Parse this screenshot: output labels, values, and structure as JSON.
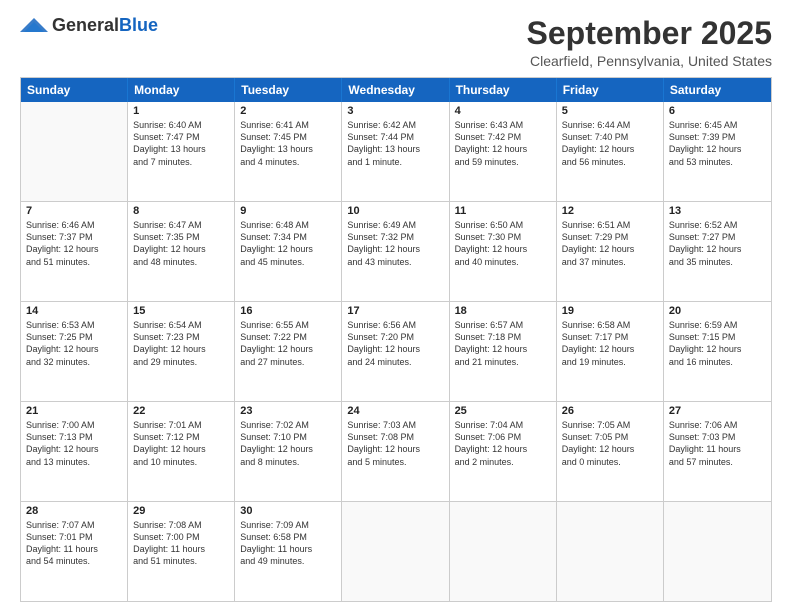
{
  "logo": {
    "general": "General",
    "blue": "Blue"
  },
  "title": "September 2025",
  "location": "Clearfield, Pennsylvania, United States",
  "header_days": [
    "Sunday",
    "Monday",
    "Tuesday",
    "Wednesday",
    "Thursday",
    "Friday",
    "Saturday"
  ],
  "weeks": [
    [
      {
        "day": "",
        "lines": []
      },
      {
        "day": "1",
        "lines": [
          "Sunrise: 6:40 AM",
          "Sunset: 7:47 PM",
          "Daylight: 13 hours",
          "and 7 minutes."
        ]
      },
      {
        "day": "2",
        "lines": [
          "Sunrise: 6:41 AM",
          "Sunset: 7:45 PM",
          "Daylight: 13 hours",
          "and 4 minutes."
        ]
      },
      {
        "day": "3",
        "lines": [
          "Sunrise: 6:42 AM",
          "Sunset: 7:44 PM",
          "Daylight: 13 hours",
          "and 1 minute."
        ]
      },
      {
        "day": "4",
        "lines": [
          "Sunrise: 6:43 AM",
          "Sunset: 7:42 PM",
          "Daylight: 12 hours",
          "and 59 minutes."
        ]
      },
      {
        "day": "5",
        "lines": [
          "Sunrise: 6:44 AM",
          "Sunset: 7:40 PM",
          "Daylight: 12 hours",
          "and 56 minutes."
        ]
      },
      {
        "day": "6",
        "lines": [
          "Sunrise: 6:45 AM",
          "Sunset: 7:39 PM",
          "Daylight: 12 hours",
          "and 53 minutes."
        ]
      }
    ],
    [
      {
        "day": "7",
        "lines": [
          "Sunrise: 6:46 AM",
          "Sunset: 7:37 PM",
          "Daylight: 12 hours",
          "and 51 minutes."
        ]
      },
      {
        "day": "8",
        "lines": [
          "Sunrise: 6:47 AM",
          "Sunset: 7:35 PM",
          "Daylight: 12 hours",
          "and 48 minutes."
        ]
      },
      {
        "day": "9",
        "lines": [
          "Sunrise: 6:48 AM",
          "Sunset: 7:34 PM",
          "Daylight: 12 hours",
          "and 45 minutes."
        ]
      },
      {
        "day": "10",
        "lines": [
          "Sunrise: 6:49 AM",
          "Sunset: 7:32 PM",
          "Daylight: 12 hours",
          "and 43 minutes."
        ]
      },
      {
        "day": "11",
        "lines": [
          "Sunrise: 6:50 AM",
          "Sunset: 7:30 PM",
          "Daylight: 12 hours",
          "and 40 minutes."
        ]
      },
      {
        "day": "12",
        "lines": [
          "Sunrise: 6:51 AM",
          "Sunset: 7:29 PM",
          "Daylight: 12 hours",
          "and 37 minutes."
        ]
      },
      {
        "day": "13",
        "lines": [
          "Sunrise: 6:52 AM",
          "Sunset: 7:27 PM",
          "Daylight: 12 hours",
          "and 35 minutes."
        ]
      }
    ],
    [
      {
        "day": "14",
        "lines": [
          "Sunrise: 6:53 AM",
          "Sunset: 7:25 PM",
          "Daylight: 12 hours",
          "and 32 minutes."
        ]
      },
      {
        "day": "15",
        "lines": [
          "Sunrise: 6:54 AM",
          "Sunset: 7:23 PM",
          "Daylight: 12 hours",
          "and 29 minutes."
        ]
      },
      {
        "day": "16",
        "lines": [
          "Sunrise: 6:55 AM",
          "Sunset: 7:22 PM",
          "Daylight: 12 hours",
          "and 27 minutes."
        ]
      },
      {
        "day": "17",
        "lines": [
          "Sunrise: 6:56 AM",
          "Sunset: 7:20 PM",
          "Daylight: 12 hours",
          "and 24 minutes."
        ]
      },
      {
        "day": "18",
        "lines": [
          "Sunrise: 6:57 AM",
          "Sunset: 7:18 PM",
          "Daylight: 12 hours",
          "and 21 minutes."
        ]
      },
      {
        "day": "19",
        "lines": [
          "Sunrise: 6:58 AM",
          "Sunset: 7:17 PM",
          "Daylight: 12 hours",
          "and 19 minutes."
        ]
      },
      {
        "day": "20",
        "lines": [
          "Sunrise: 6:59 AM",
          "Sunset: 7:15 PM",
          "Daylight: 12 hours",
          "and 16 minutes."
        ]
      }
    ],
    [
      {
        "day": "21",
        "lines": [
          "Sunrise: 7:00 AM",
          "Sunset: 7:13 PM",
          "Daylight: 12 hours",
          "and 13 minutes."
        ]
      },
      {
        "day": "22",
        "lines": [
          "Sunrise: 7:01 AM",
          "Sunset: 7:12 PM",
          "Daylight: 12 hours",
          "and 10 minutes."
        ]
      },
      {
        "day": "23",
        "lines": [
          "Sunrise: 7:02 AM",
          "Sunset: 7:10 PM",
          "Daylight: 12 hours",
          "and 8 minutes."
        ]
      },
      {
        "day": "24",
        "lines": [
          "Sunrise: 7:03 AM",
          "Sunset: 7:08 PM",
          "Daylight: 12 hours",
          "and 5 minutes."
        ]
      },
      {
        "day": "25",
        "lines": [
          "Sunrise: 7:04 AM",
          "Sunset: 7:06 PM",
          "Daylight: 12 hours",
          "and 2 minutes."
        ]
      },
      {
        "day": "26",
        "lines": [
          "Sunrise: 7:05 AM",
          "Sunset: 7:05 PM",
          "Daylight: 12 hours",
          "and 0 minutes."
        ]
      },
      {
        "day": "27",
        "lines": [
          "Sunrise: 7:06 AM",
          "Sunset: 7:03 PM",
          "Daylight: 11 hours",
          "and 57 minutes."
        ]
      }
    ],
    [
      {
        "day": "28",
        "lines": [
          "Sunrise: 7:07 AM",
          "Sunset: 7:01 PM",
          "Daylight: 11 hours",
          "and 54 minutes."
        ]
      },
      {
        "day": "29",
        "lines": [
          "Sunrise: 7:08 AM",
          "Sunset: 7:00 PM",
          "Daylight: 11 hours",
          "and 51 minutes."
        ]
      },
      {
        "day": "30",
        "lines": [
          "Sunrise: 7:09 AM",
          "Sunset: 6:58 PM",
          "Daylight: 11 hours",
          "and 49 minutes."
        ]
      },
      {
        "day": "",
        "lines": []
      },
      {
        "day": "",
        "lines": []
      },
      {
        "day": "",
        "lines": []
      },
      {
        "day": "",
        "lines": []
      }
    ]
  ]
}
